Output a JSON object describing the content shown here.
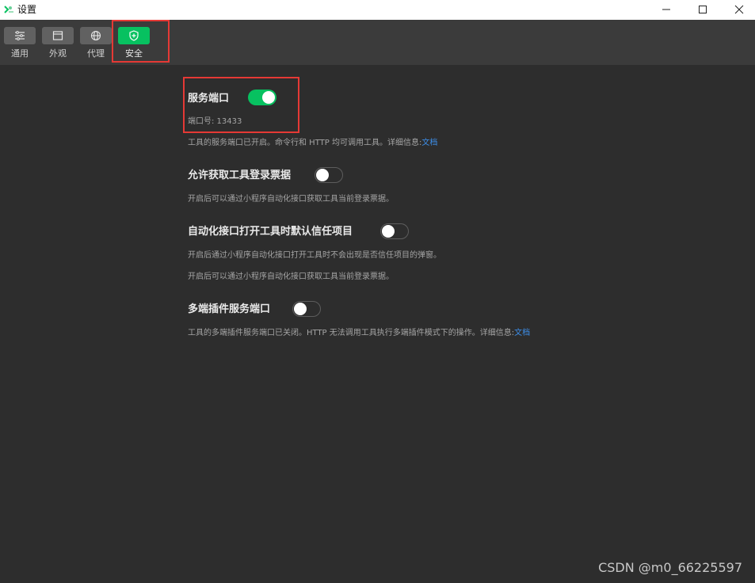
{
  "window": {
    "title": "设置",
    "icon": "wechat-devtools-logo-icon",
    "controls": [
      "minimize-icon",
      "maximize-icon",
      "close-icon"
    ]
  },
  "toolbar": {
    "items": [
      {
        "label": "通用",
        "icon": "sliders-icon",
        "active": false
      },
      {
        "label": "外观",
        "icon": "window-icon",
        "active": false
      },
      {
        "label": "代理",
        "icon": "globe-icon",
        "active": false
      },
      {
        "label": "安全",
        "icon": "shield-icon",
        "active": true
      }
    ]
  },
  "settings": {
    "service_port": {
      "title": "服务端口",
      "enabled": true,
      "port_label": "端口号: 13433",
      "desc_text": "工具的服务端口已开启。命令行和 HTTP 均可调用工具。详细信息:",
      "desc_link": "文档"
    },
    "login_ticket": {
      "title": "允许获取工具登录票据",
      "enabled": false,
      "desc": "开启后可以通过小程序自动化接口获取工具当前登录票据。"
    },
    "auto_trust": {
      "title": "自动化接口打开工具时默认信任项目",
      "enabled": false,
      "desc1": "开启后通过小程序自动化接口打开工具时不会出现是否信任项目的弹窗。",
      "desc2": "开启后可以通过小程序自动化接口获取工具当前登录票据。"
    },
    "multi_plugin_port": {
      "title": "多端插件服务端口",
      "enabled": false,
      "desc_text": "工具的多端插件服务端口已关闭。HTTP 无法调用工具执行多端插件模式下的操作。详细信息:",
      "desc_link": "文档"
    }
  },
  "colors": {
    "accent": "#07c160",
    "background": "#2d2d2d",
    "toolbar": "#3b3b3b",
    "link": "#3d8ee8",
    "highlight": "#e53935"
  },
  "watermark": "CSDN @m0_66225597"
}
